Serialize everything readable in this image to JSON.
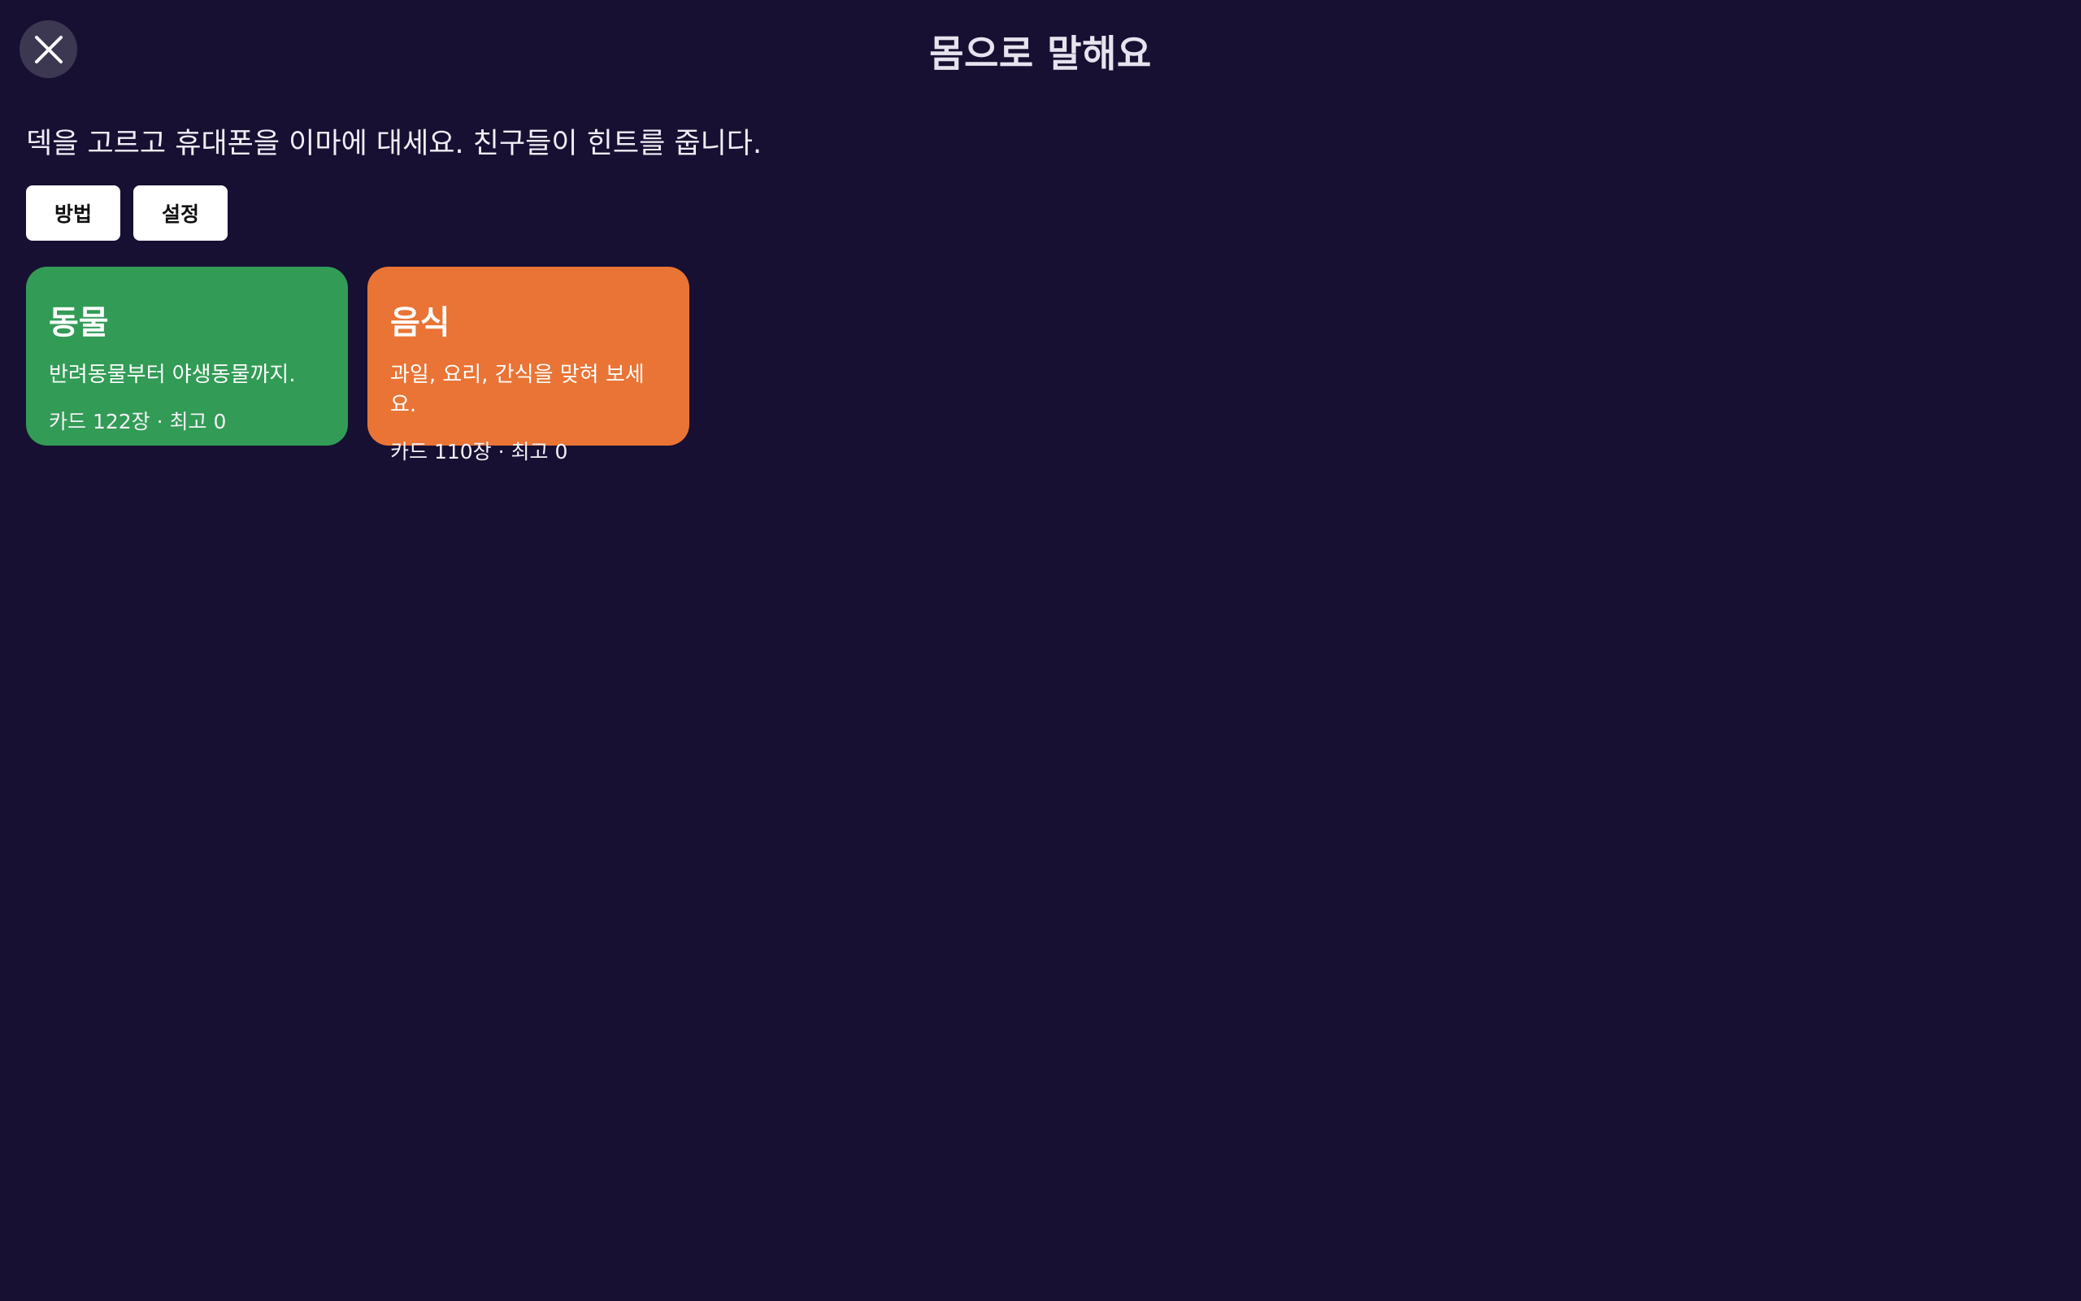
{
  "header": {
    "title": "몸으로 말해요",
    "close_icon": "close-icon"
  },
  "intro": {
    "text": "덱을 고르고 휴대폰을 이마에 대세요. 친구들이 힌트를 줍니다."
  },
  "toolbar": {
    "how_label": "방법",
    "settings_label": "설정"
  },
  "decks": [
    {
      "name": "동물",
      "description": "반려동물부터 야생동물까지.",
      "meta": "카드 122장 · 최고 0",
      "color": "#329b56"
    },
    {
      "name": "음식",
      "description": "과일, 요리, 간식을 맞혀 보세요.",
      "meta": "카드 110장 · 최고 0",
      "color": "#e97435"
    }
  ],
  "colors": {
    "background": "#171032",
    "close_button": "#3d3852"
  }
}
